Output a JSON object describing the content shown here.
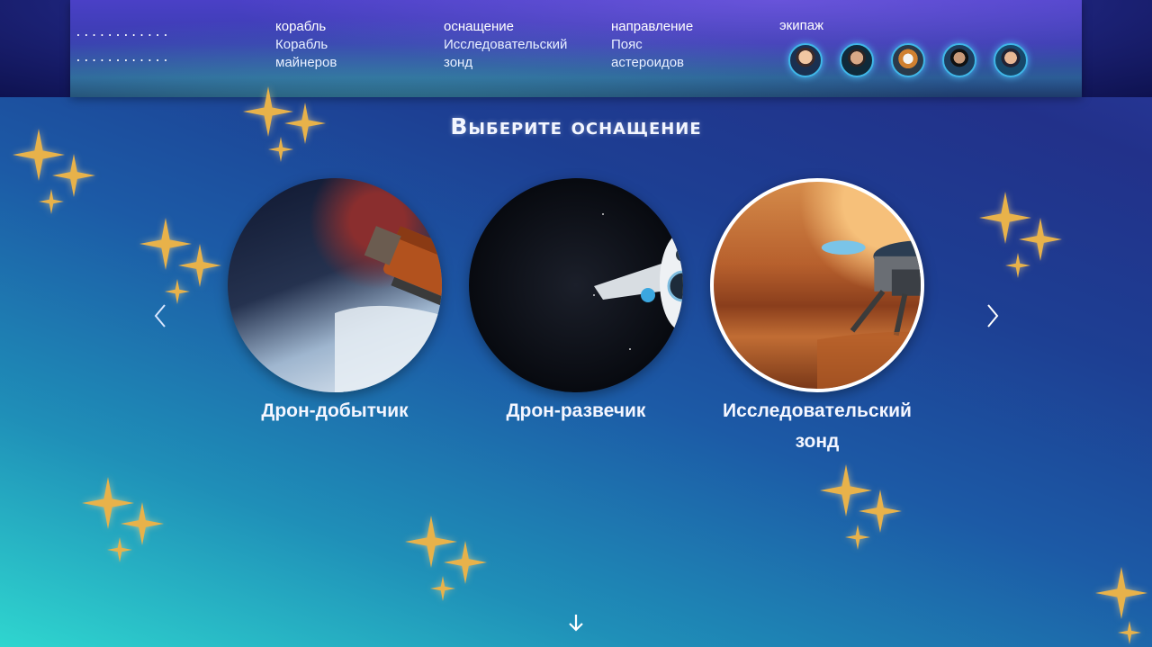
{
  "header": {
    "placeholder_line_1": "............",
    "placeholder_line_2": "............",
    "ship": {
      "key": "корабль",
      "value": "Корабль майнеров"
    },
    "equipment": {
      "key": "оснащение",
      "value": "Исследовательский зонд"
    },
    "direction": {
      "key": "направление",
      "value": "Пояс астероидов"
    },
    "crew": {
      "key": "экипаж",
      "avatars": [
        "crew-avatar-1",
        "crew-avatar-2",
        "crew-avatar-3",
        "crew-avatar-4",
        "crew-avatar-5"
      ]
    }
  },
  "main": {
    "title": "Выберите оснащение",
    "options": [
      {
        "label": "Дрон-добытчик",
        "selected": false
      },
      {
        "label": "Дрон-развечик",
        "selected": false
      },
      {
        "label": "Исследовательский зонд",
        "selected": true
      }
    ],
    "prev_icon": "chevron-left-icon",
    "next_icon": "chevron-right-icon",
    "scroll_icon": "arrow-down-icon"
  },
  "colors": {
    "star": "#e8b24a",
    "accent": "#3fb7e8",
    "gradient_start": "#2fd6cf",
    "gradient_end": "#22318a"
  }
}
